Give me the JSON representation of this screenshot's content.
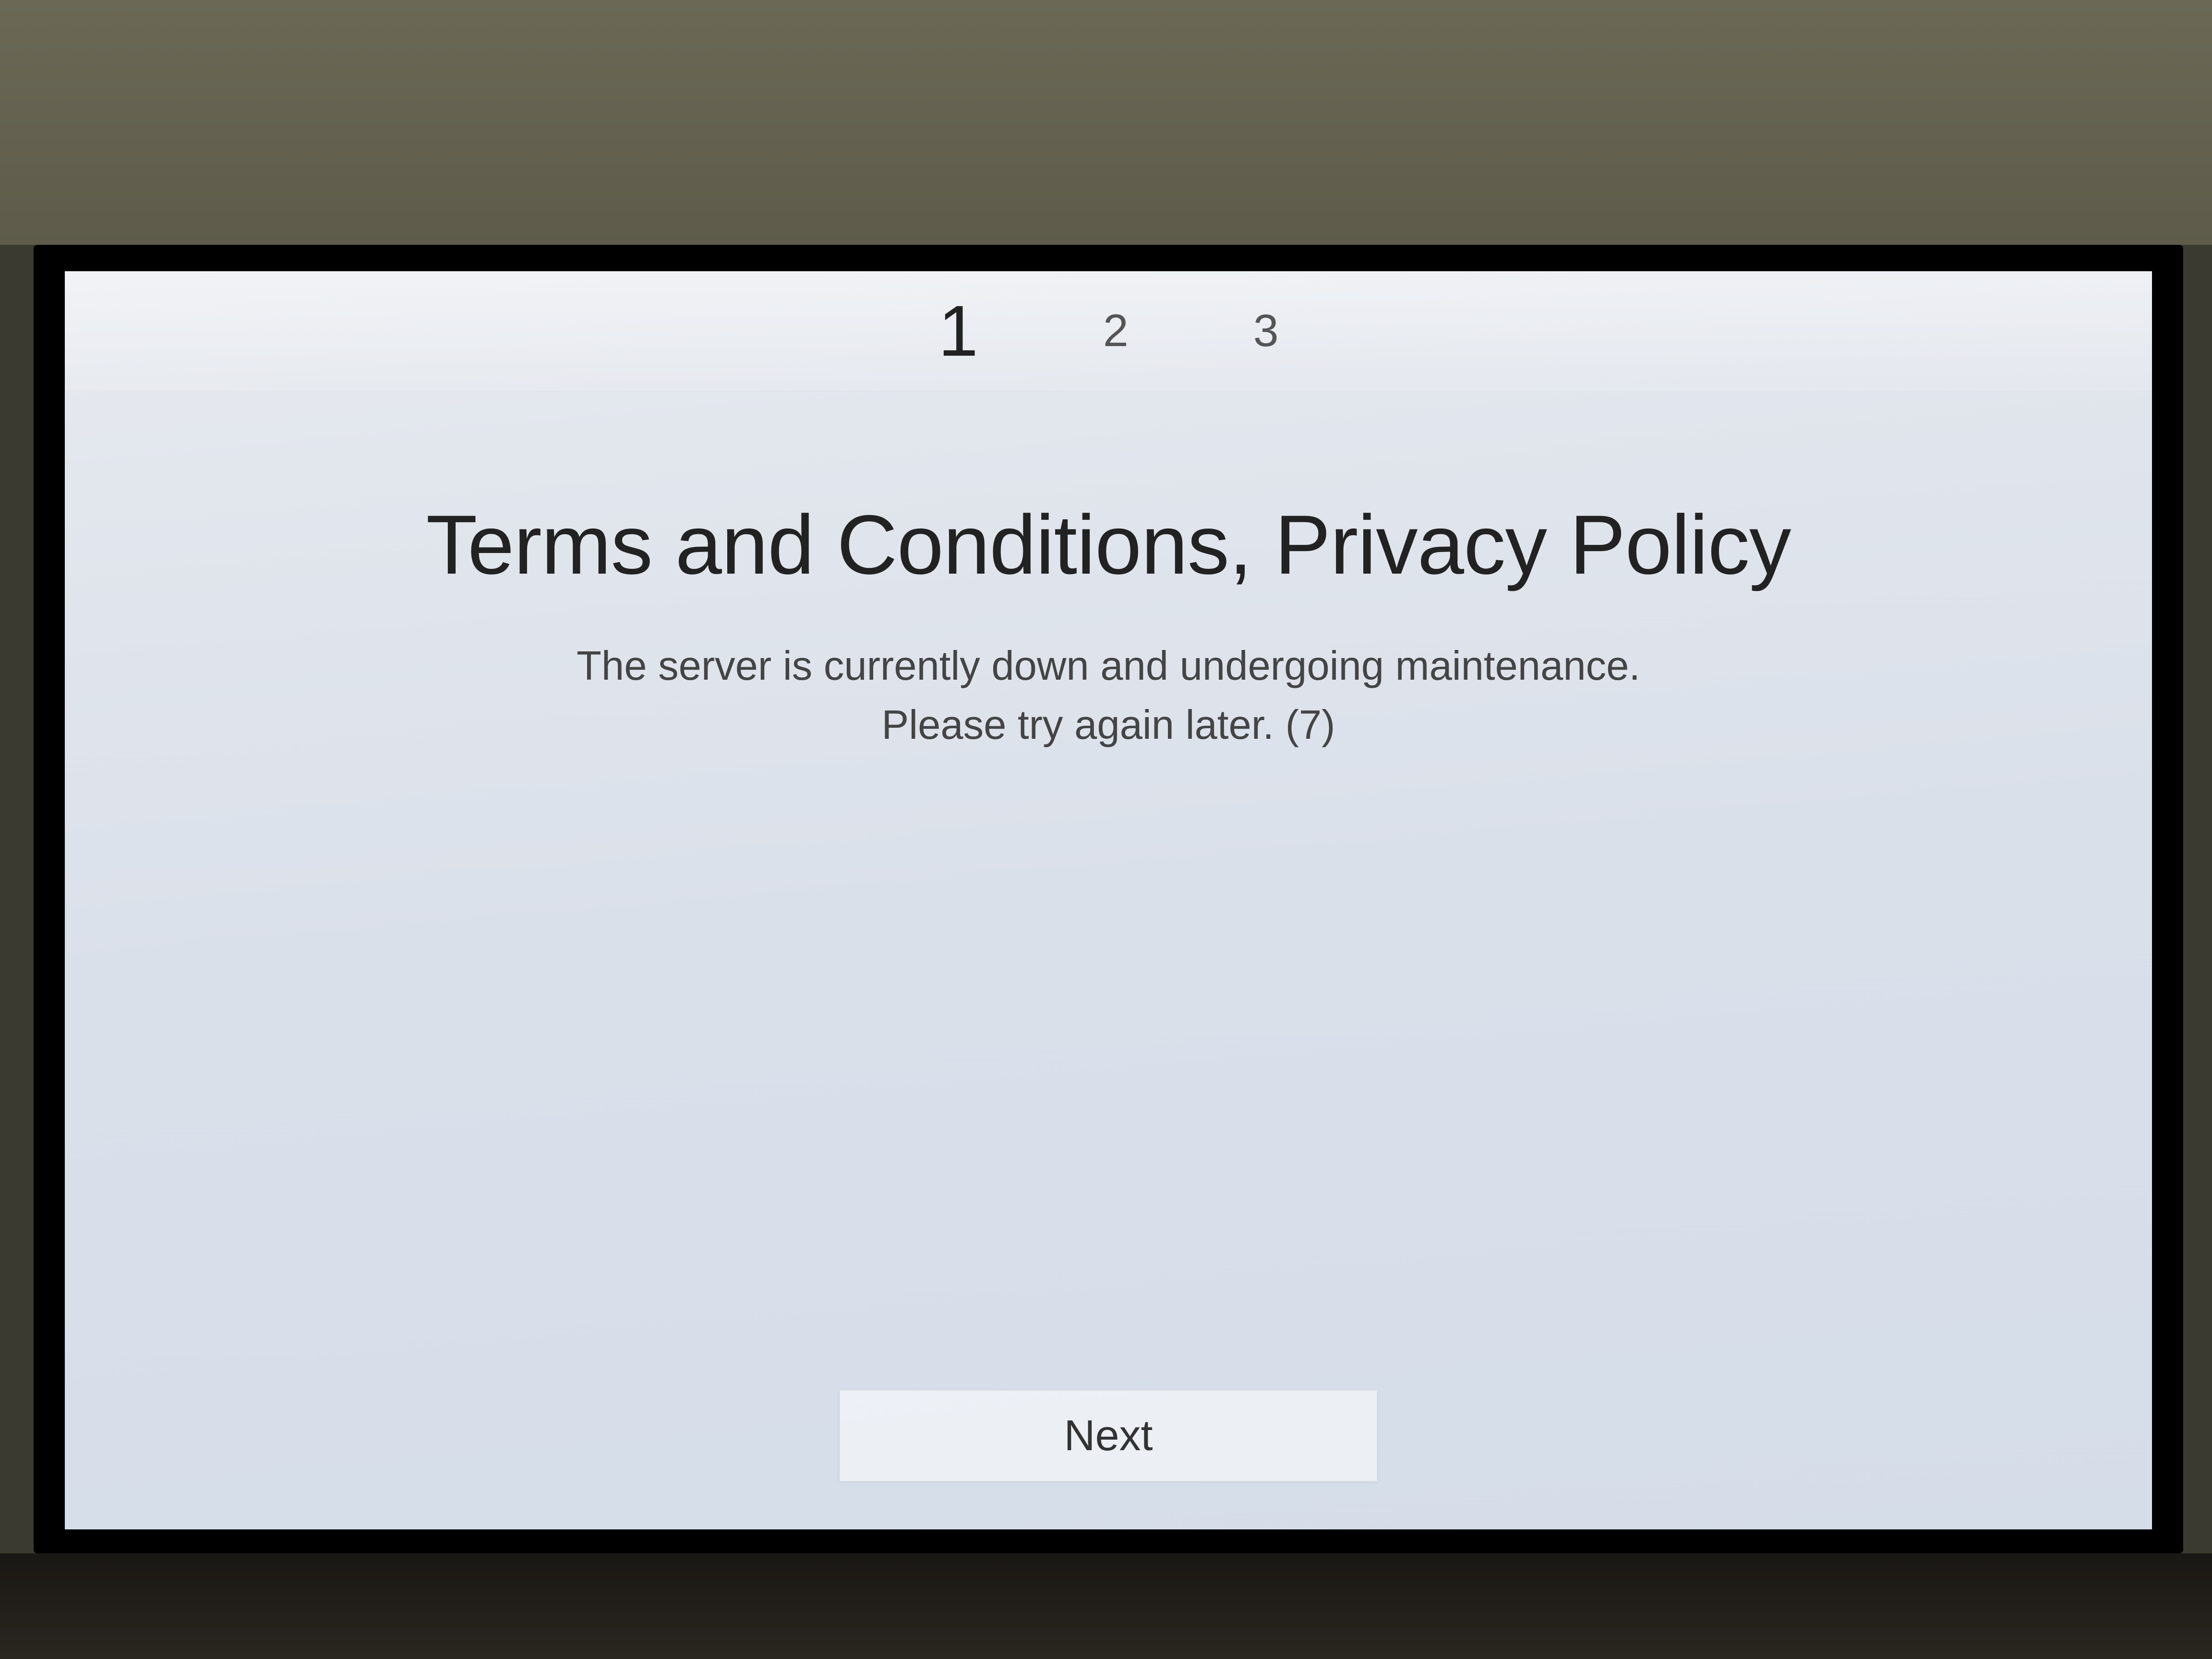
{
  "steps": {
    "items": [
      "1",
      "2",
      "3"
    ],
    "active_index": 0
  },
  "main": {
    "title": "Terms and Conditions, Privacy Policy",
    "message_line1": "The server is currently down and undergoing maintenance.",
    "message_line2": "Please try again later. (7)"
  },
  "footer": {
    "next_label": "Next"
  }
}
